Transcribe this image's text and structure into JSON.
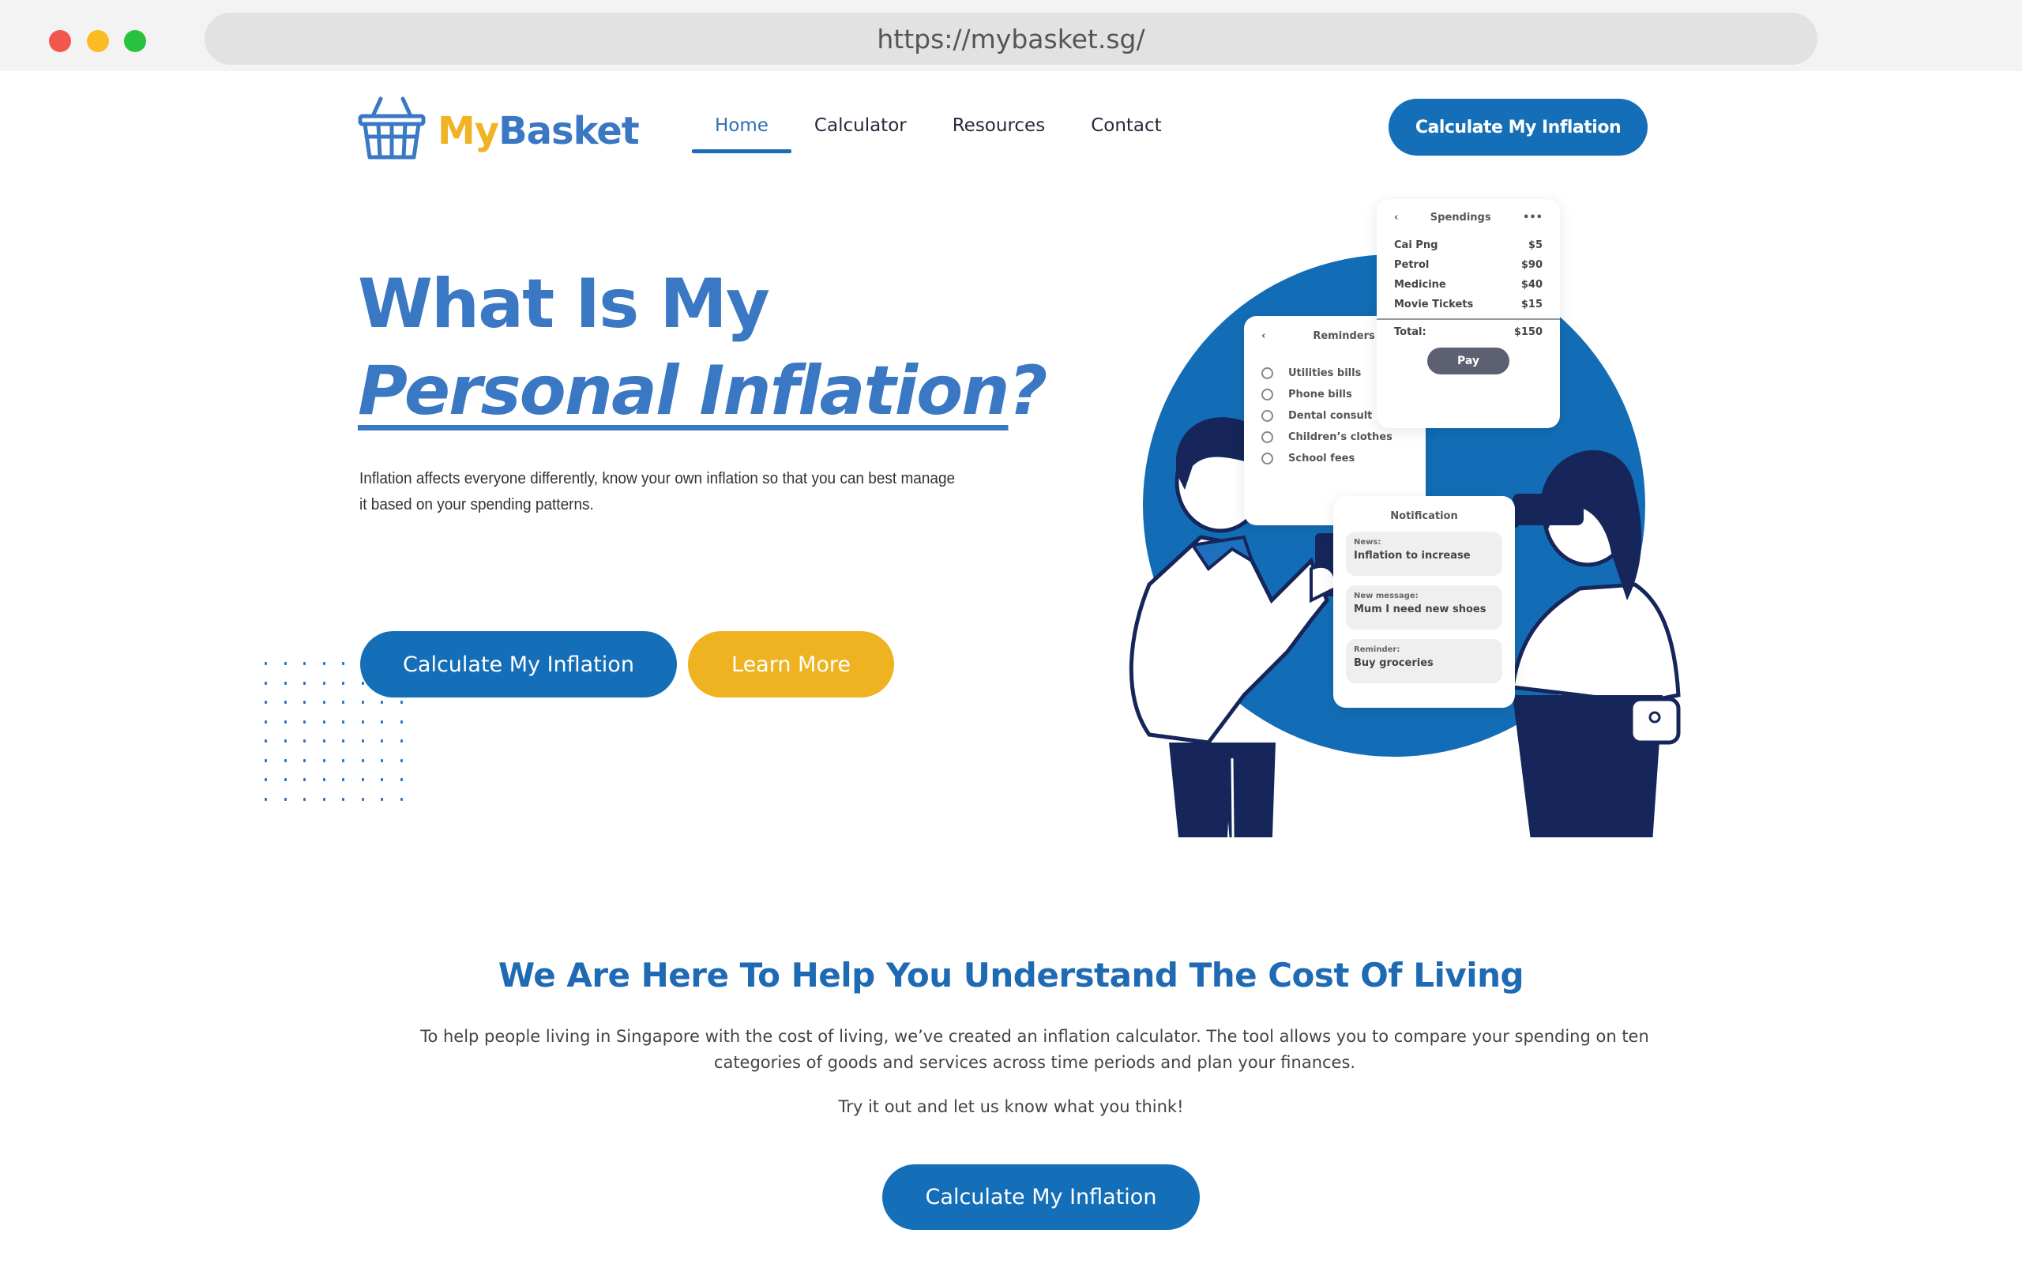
{
  "browser": {
    "url": "https://mybasket.sg/"
  },
  "header": {
    "logo": {
      "my": "My",
      "basket": "Basket",
      "icon": "basket-icon"
    },
    "nav": [
      {
        "label": "Home",
        "active": true
      },
      {
        "label": "Calculator",
        "active": false
      },
      {
        "label": "Resources",
        "active": false
      },
      {
        "label": "Contact",
        "active": false
      }
    ],
    "cta_label": "Calculate My Inflation"
  },
  "hero": {
    "title_line1": "What Is My",
    "title_line2": "Personal Inflation",
    "title_line2_suffix": "?",
    "description": "Inflation affects everyone differently, know your own inflation so that you can best manage it based on your spending patterns.",
    "primary_button": "Calculate My Inflation",
    "secondary_button": "Learn More"
  },
  "illustration": {
    "spendings": {
      "title": "Spendings",
      "back": "‹",
      "more": "•••",
      "items": [
        {
          "name": "Cai Png",
          "amount": "$5"
        },
        {
          "name": "Petrol",
          "amount": "$90"
        },
        {
          "name": "Medicine",
          "amount": "$40"
        },
        {
          "name": "Movie Tickets",
          "amount": "$15"
        }
      ],
      "total_label": "Total:",
      "total_amount": "$150",
      "pay_label": "Pay"
    },
    "reminders": {
      "title": "Reminders",
      "back": "‹",
      "items": [
        "Utilities bills",
        "Phone bills",
        "Dental consult",
        "Children’s clothes",
        "School fees"
      ]
    },
    "notification": {
      "title": "Notification",
      "items": [
        {
          "kind": "News:",
          "text": "Inflation to increase"
        },
        {
          "kind": "New message:",
          "text": "Mum I need new shoes"
        },
        {
          "kind": "Reminder:",
          "text": "Buy groceries"
        }
      ]
    }
  },
  "about": {
    "title": "We Are Here To Help You Understand The Cost Of Living",
    "paragraph": "To help people living in Singapore with the cost of living, we’ve created an inflation calculator. The tool allows you to compare your spending on ten categories of goods and services across time periods and plan your finances.",
    "try_text": "Try it out and let us know what you think!",
    "button": "Calculate My Inflation"
  },
  "colors": {
    "primary_blue": "#146eb8",
    "title_blue": "#3b78c4",
    "accent_yellow": "#efb321",
    "navy": "#16265a"
  }
}
